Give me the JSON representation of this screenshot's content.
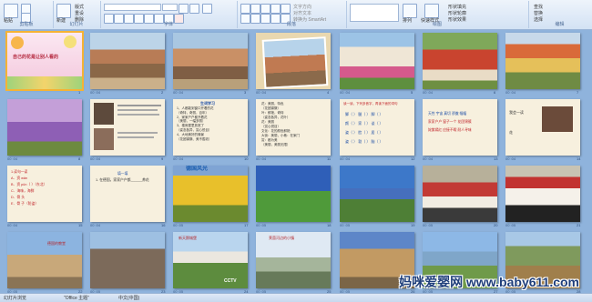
{
  "ribbon": {
    "groups": [
      {
        "label": "剪贴板"
      },
      {
        "label": "幻灯片"
      },
      {
        "label": "字体"
      },
      {
        "label": "段落"
      },
      {
        "label": "绘图"
      },
      {
        "label": "编辑"
      }
    ],
    "items": {
      "paste": "粘贴",
      "new_slide": "新建",
      "reset": "重设",
      "layout": "版式",
      "delete": "删除",
      "shape_fill": "形状填充",
      "shape_outline": "形状轮廓",
      "shape_effect": "形状效果",
      "quick_style": "快速样式",
      "arrange": "排列",
      "find": "查找",
      "replace": "替换",
      "select": "选择",
      "text_direction": "文字方向",
      "align_text": "对齐文本",
      "smartart": "转换为 SmartArt"
    }
  },
  "slides": [
    {
      "n": "1",
      "time": "",
      "title": "自己的花是让别人看的"
    },
    {
      "n": "2",
      "time": "00 :04"
    },
    {
      "n": "3",
      "time": "00 :04"
    },
    {
      "n": "4",
      "time": "00 :04"
    },
    {
      "n": "5",
      "time": "00 :04"
    },
    {
      "n": "6",
      "time": "00 :04"
    },
    {
      "n": "7",
      "time": "00 :04"
    },
    {
      "n": "8",
      "time": "00 :04"
    },
    {
      "n": "9",
      "time": "00 :04"
    },
    {
      "n": "10",
      "time": "00 :04",
      "title": "生词学习"
    },
    {
      "n": "11",
      "time": "00 :04"
    },
    {
      "n": "12",
      "time": "00 :04"
    },
    {
      "n": "13",
      "time": "00 :04"
    },
    {
      "n": "14",
      "time": "00 :04",
      "title": "我会读"
    },
    {
      "n": "15",
      "time": "00 :04",
      "title": "填一填"
    },
    {
      "n": "16",
      "time": "00 :04",
      "title": "德国风光"
    },
    {
      "n": "17",
      "time": "00 :05"
    },
    {
      "n": "18",
      "time": "00 :05"
    },
    {
      "n": "19",
      "time": "00 :05"
    },
    {
      "n": "20",
      "time": "00 :05"
    },
    {
      "n": "21",
      "time": "00 :05"
    },
    {
      "n": "22",
      "time": "00 :05",
      "title": "德国的教堂"
    },
    {
      "n": "23",
      "time": "00 :05"
    },
    {
      "n": "24",
      "time": "00 :05",
      "title": "新天鹅城堡"
    },
    {
      "n": "25",
      "time": "00 :05",
      "title": "莱茵河边的小镇"
    },
    {
      "n": "26",
      "time": "00 :05"
    },
    {
      "n": "27",
      "time": "00 :05"
    },
    {
      "n": "28",
      "time": "00 :05"
    }
  ],
  "slide_text": {
    "s10_lines": [
      "1、人都能到窗口开着的花",
      "（奇特，奇丽，百年）",
      "2、家家户户都开着花",
      "（美丽，一幅多丽）",
      "3、楼房屋里放宽了",
      "（姿态各异，赏心悦目）",
      "4、大地美好的情景",
      "（花团锦簇、美不胜收）"
    ],
    "s11_lines": [
      "花：美丽，特色",
      "（花团锦簇）",
      "叶：鲜艳，奇特",
      "（姿态各异，花叶）",
      "花：美丽",
      "（赏心悦目）",
      "文化：花的颜色鲜艳",
      "大街：美丽，小巷：在家门",
      "赏：都为美",
      "（美丽，美丽无限）"
    ],
    "s12_head": "读一读，下列多音字，再读下面的词句",
    "s12_lines": [
      "脚（ ）  腿（ ）  脚（ ）",
      "颜（ ）  家（ ）  谈（ ）",
      "姿（ ）  脸（ ）  居（ ）",
      "姿（ ）  勃（ ）  脑（ ）"
    ],
    "s13_lines": [
      "天性   宇宙   真切   骄傲   幅幅",
      "家家户户   窗子一个   花团锦簇",
      "姹紫嫣红   应接不暇   耐人寻味"
    ],
    "s14_lines": [
      "我会一读",
      "花"
    ],
    "s15_lines": [
      "1.读句一读",
      "A．资  wǎn",
      "B．资  pǔn（  ）（东北）",
      "C．海味，海鲜",
      "D．骨  头",
      "E．骨  子（防盗）"
    ],
    "s16_lines": [
      "填一填",
      "1. 在德国，家家户户都______养花"
    ],
    "s25_cctv": "CCTV"
  },
  "status": {
    "view": "幻灯片浏览",
    "theme": "\"Office 主题\"",
    "lang": "中文(中国)"
  },
  "watermark": "妈咪爱婴网 www.baby611.com"
}
